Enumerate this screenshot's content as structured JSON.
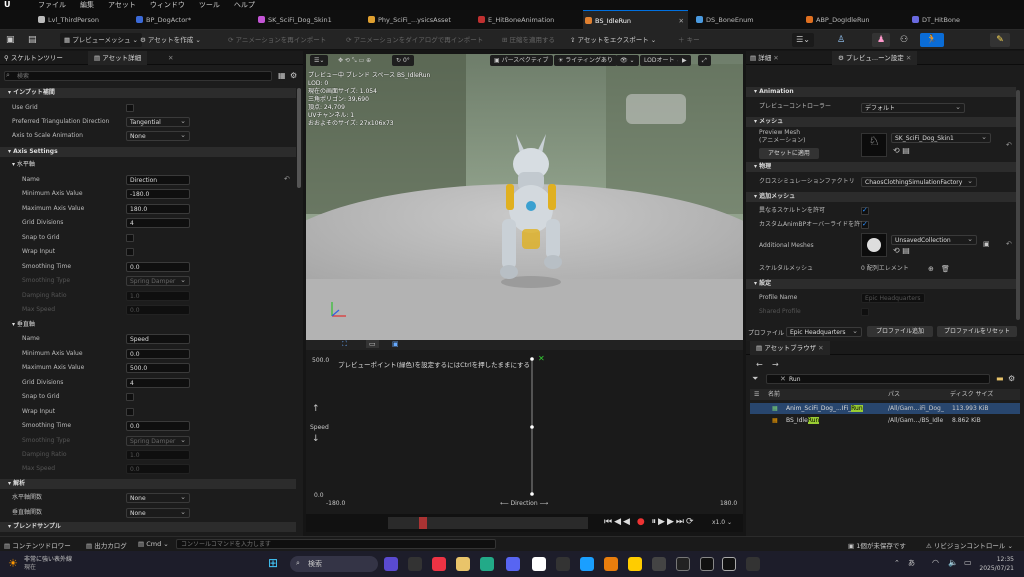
{
  "menu": [
    "ファイル",
    "編集",
    "アセット",
    "ウィンドウ",
    "ツール",
    "ヘルプ"
  ],
  "tabs": [
    {
      "label": "Lvl_ThirdPerson",
      "color": "#bbbbbb"
    },
    {
      "label": "BP_DogActor*",
      "color": "#3b6ad8"
    },
    {
      "label": "SK_SciFi_Dog_Skin1",
      "color": "#c455d6"
    },
    {
      "label": "Phy_SciFi_...ysicsAsset",
      "color": "#e0a030"
    },
    {
      "label": "E_HitBoneAnimation",
      "color": "#c03030"
    },
    {
      "label": "BS_IdleRun",
      "color": "#e08030"
    },
    {
      "label": "DS_BoneEnum",
      "color": "#4a9ae0"
    },
    {
      "label": "ABP_DogIdleRun",
      "color": "#e07020"
    },
    {
      "label": "DT_HitBone",
      "color": "#6a6ae0"
    }
  ],
  "toolbar": {
    "preview_mesh": "プレビューメッシュ",
    "create_asset": "アセットを作成",
    "reimport": "アニメーションを再インポート",
    "reimport_dialog": "アニメーションをダイアログで再インポート",
    "apply_compress": "圧縮を適用する",
    "export_asset": "アセットをエクスポート",
    "add_key": "キー"
  },
  "left_tabs": {
    "skeleton_tree": "スケルトンツリー",
    "asset_details": "アセット詳細"
  },
  "search_placeholder": "検索",
  "input_interp": {
    "title": "インプット補間",
    "use_grid": "Use Grid",
    "pref_tri": "Preferred Triangulation Direction",
    "pref_tri_val": "Tangential",
    "axis_scale": "Axis to Scale Animation",
    "axis_scale_val": "None"
  },
  "axis_settings": {
    "title": "Axis Settings"
  },
  "h_axis": {
    "title": "水平軸",
    "name_label": "Name",
    "name": "Direction",
    "min_label": "Minimum Axis Value",
    "min": "-180.0",
    "max_label": "Maximum Axis Value",
    "max": "180.0",
    "grid_label": "Grid Divisions",
    "grid": "4",
    "snap_label": "Snap to Grid",
    "wrap_label": "Wrap Input",
    "smooth_label": "Smoothing Time",
    "smooth": "0.0",
    "stype_label": "Smoothing Type",
    "stype": "Spring Damper",
    "damp_label": "Damping Ratio",
    "damp": "1.0",
    "maxspd_label": "Max Speed",
    "maxspd": "0.0"
  },
  "v_axis": {
    "title": "垂直軸",
    "name_label": "Name",
    "name": "Speed",
    "min_label": "Minimum Axis Value",
    "min": "0.0",
    "max_label": "Maximum Axis Value",
    "max": "500.0",
    "grid_label": "Grid Divisions",
    "grid": "4",
    "snap_label": "Snap to Grid",
    "wrap_label": "Wrap Input",
    "smooth_label": "Smoothing Time",
    "smooth": "0.0",
    "stype_label": "Smoothing Type",
    "stype": "Spring Damper",
    "damp_label": "Damping Ratio",
    "damp": "1.0",
    "maxspd_label": "Max Speed",
    "maxspd": "0.0"
  },
  "analysis": {
    "title": "解析",
    "h_func": "水平軸関数",
    "h_val": "None",
    "v_func": "垂直軸関数",
    "v_val": "None"
  },
  "blend_samples": "ブレンドサンプル",
  "viewport": {
    "perspective": "パースペクティブ",
    "lighting": "ライティングあり",
    "lod": "LODオート",
    "rot": "0°",
    "info": [
      "プレビュー中 ブレンド スペース BS_IdleRun",
      "LOD: 0",
      "現在の画面サイズ: 1.054",
      "三角ポリゴン: 39,690",
      "頂点: 24,709",
      "UVチャンネル: 1",
      "おおよそのサイズ: 27x106x73"
    ]
  },
  "blend": {
    "hint": "プレビューポイント(緑色)を設定するにはCtrlを押したままにする",
    "y_max": "500.0",
    "y_min": "0.0",
    "y_label": "Speed",
    "x_min": "-180.0",
    "x_max": "180.0",
    "x_label": "Direction",
    "speed": "x1.0"
  },
  "right_tabs": {
    "details": "詳細",
    "preview_settings": "プレビュ...ーン設定"
  },
  "rp": {
    "animation": "Animation",
    "preview_ctrl": "プレビューコントローラー",
    "preview_ctrl_val": "デフォルト",
    "mesh": "メッシュ",
    "preview_mesh": "Preview Mesh",
    "preview_mesh_sub": "(アニメーション)",
    "mesh_val": "SK_SciFi_Dog_Skin1",
    "apply_btn": "アセットに適用",
    "physics": "物理",
    "cloth": "クロスシミュレーションファクトリ",
    "cloth_val": "ChaosClothingSimulationFactory",
    "add_mesh": "追加メッシュ",
    "diff_skel": "異なるスケルトンを許可",
    "custom_anim": "カスタムAnimBPオーバーライドを許可",
    "add_meshes": "Additional Meshes",
    "add_meshes_val": "UnsavedCollection",
    "skel_mesh": "スケルタルメッシュ",
    "skel_mesh_val": "0 配列エレメント",
    "settings": "設定",
    "profile_name": "Profile Name",
    "profile_name_val": "Epic Headquarters",
    "shared": "Shared Profile",
    "profile_label": "プロファイル",
    "profile_val": "Epic Headquarters",
    "add_profile": "プロファイル追加",
    "reset_profile": "プロファイルをリセット"
  },
  "asset_browser": {
    "title": "アセットブラウザ",
    "search": "Run",
    "col_name": "名前",
    "col_path": "パス",
    "col_size": "ディスク サイズ",
    "rows": [
      {
        "name_pre": "Anim_SciFi_Dog_...IFi_",
        "name_hl": "Run",
        "path": "/All/Gam...iFi_Dog_",
        "size": "113.993 KiB",
        "selected": true
      },
      {
        "name_pre": "BS_Idle",
        "name_hl": "Run",
        "path": "/All/Gam.../BS_Idle",
        "size": "8.862 KiB",
        "selected": false
      }
    ],
    "status": "1個が未保存です",
    "revision": "リビジョンコントロール"
  },
  "status": {
    "drawer": "コンテンツドロワー",
    "log": "出力カログ",
    "cmd": "Cmd",
    "console_ph": "コンソールコマンドを入力します"
  },
  "taskbar": {
    "weather": "非常に強い表外線",
    "weather_sub": "現在",
    "search": "検索",
    "time": "12:35",
    "date": "2025/07/21",
    "lang": "あ"
  }
}
